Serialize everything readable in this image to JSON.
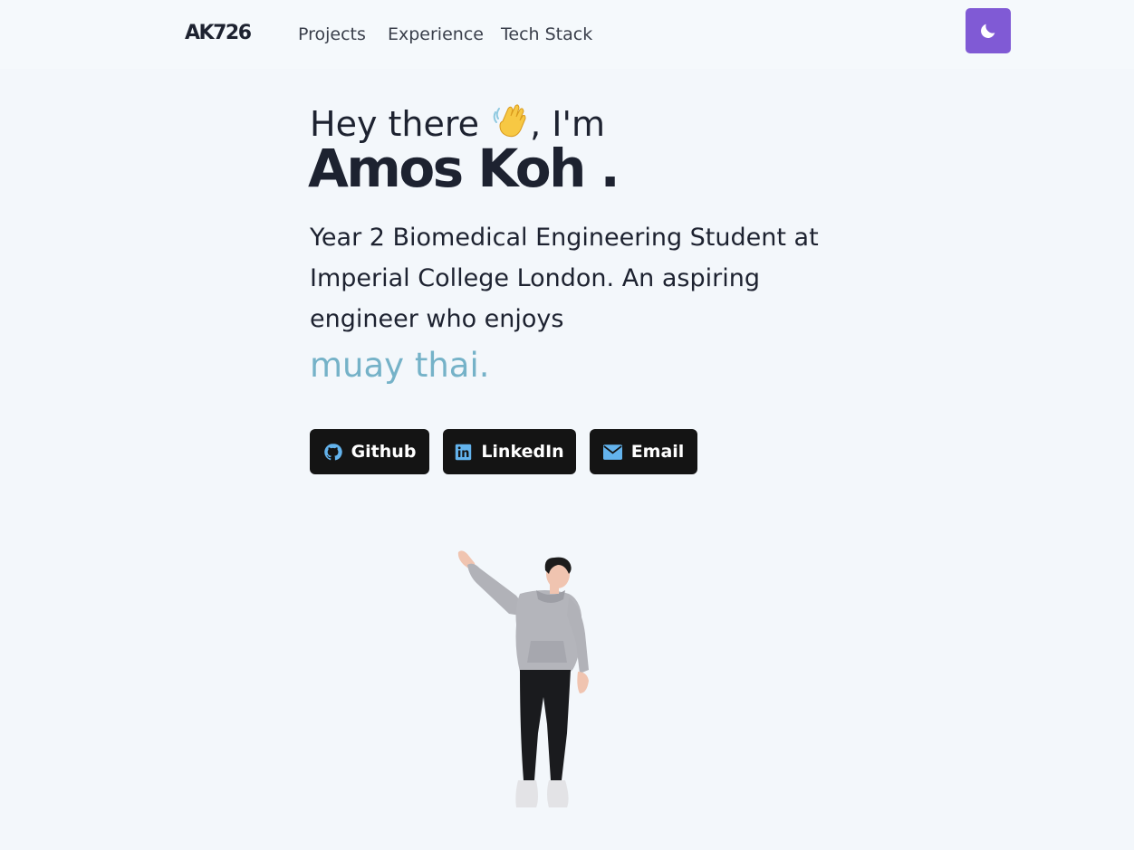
{
  "nav": {
    "logo": "AK726",
    "links": [
      "Projects",
      "Experience",
      "Tech Stack"
    ],
    "theme_toggle_icon": "moon-icon",
    "accent": "#805ad5"
  },
  "hero": {
    "greeting_before": "Hey there ",
    "greeting_after": ", I'm",
    "wave_icon": "waving-hand-icon",
    "name": "Amos Koh .",
    "description": "Year 2 Biomedical Engineering Student at Imperial College London. An aspiring engineer who enjoys",
    "hobby": "muay thai.",
    "hobby_color": "#75b2c8"
  },
  "social_buttons": [
    {
      "label": "Github",
      "icon": "github-icon"
    },
    {
      "label": "LinkedIn",
      "icon": "linkedin-icon"
    },
    {
      "label": "Email",
      "icon": "mail-icon"
    }
  ],
  "avatar_icon": "waving-3d-avatar"
}
